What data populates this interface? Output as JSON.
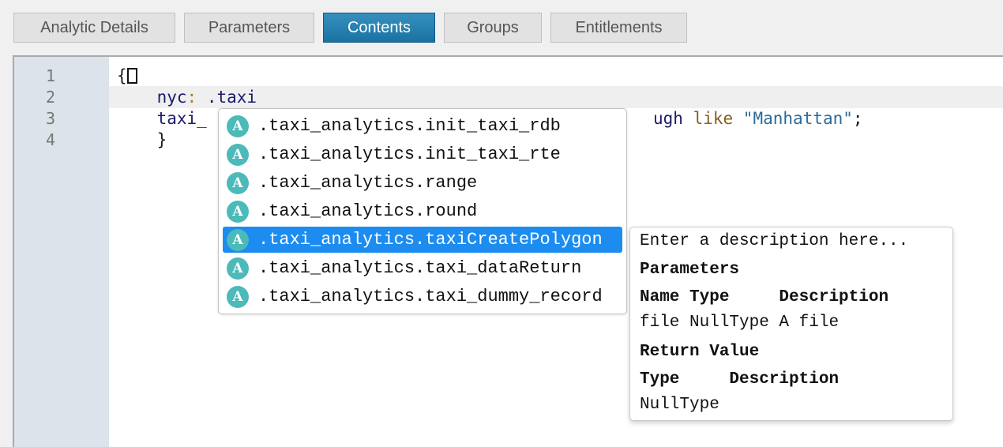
{
  "tabs": [
    {
      "label": "Analytic Details",
      "active": false
    },
    {
      "label": "Parameters",
      "active": false
    },
    {
      "label": "Contents",
      "active": true
    },
    {
      "label": "Groups",
      "active": false
    },
    {
      "label": "Entitlements",
      "active": false
    }
  ],
  "editor": {
    "line_numbers": [
      "1",
      "2",
      "3",
      "4"
    ],
    "lines": {
      "l1_brace": "{",
      "l2_indent": "    ",
      "l2_key": "nyc",
      "l2_colon": ":",
      "l2_value": " .taxi",
      "l3_indent": "    ",
      "l3_start": "taxi_",
      "l3_tail_ident": "ugh",
      "l3_kw": " like ",
      "l3_str": "\"Manhattan\"",
      "l3_semicolon": ";",
      "l4_indent": "    ",
      "l4_brace": "}"
    }
  },
  "autocomplete": {
    "icon_letter": "A",
    "items": [
      {
        "label": ".taxi_analytics.init_taxi_rdb",
        "selected": false
      },
      {
        "label": ".taxi_analytics.init_taxi_rte",
        "selected": false
      },
      {
        "label": ".taxi_analytics.range",
        "selected": false
      },
      {
        "label": ".taxi_analytics.round",
        "selected": false
      },
      {
        "label": ".taxi_analytics.taxiCreatePolygon",
        "selected": true
      },
      {
        "label": ".taxi_analytics.taxi_dataReturn",
        "selected": false
      },
      {
        "label": ".taxi_analytics.taxi_dummy_record",
        "selected": false
      }
    ]
  },
  "doc_tooltip": {
    "description": "Enter a description here...",
    "parameters_heading": "Parameters",
    "params_header": "Name Type     Description",
    "params_rows": [
      "file NullType A file"
    ],
    "return_heading": "Return Value",
    "return_header": "Type     Description",
    "return_rows": [
      "NullType"
    ]
  },
  "colors": {
    "tab_active": "#1a72a3",
    "selection": "#1c8cf0",
    "icon_teal": "#4bbab9",
    "gutter": "#dce3ea"
  }
}
